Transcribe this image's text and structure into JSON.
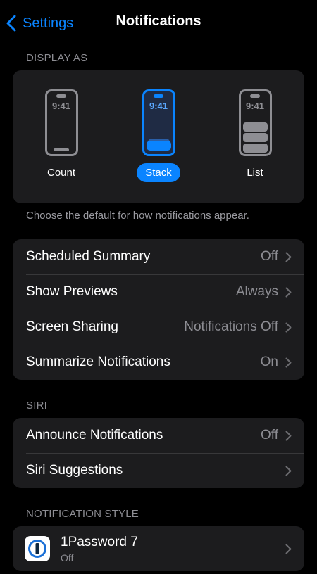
{
  "nav": {
    "back_label": "Settings",
    "title": "Notifications"
  },
  "display_as": {
    "header": "DISPLAY AS",
    "options": [
      {
        "label": "Count",
        "time": "9:41",
        "selected": false
      },
      {
        "label": "Stack",
        "time": "9:41",
        "selected": true
      },
      {
        "label": "List",
        "time": "9:41",
        "selected": false
      }
    ],
    "footer": "Choose the default for how notifications appear."
  },
  "general": {
    "rows": [
      {
        "label": "Scheduled Summary",
        "value": "Off"
      },
      {
        "label": "Show Previews",
        "value": "Always"
      },
      {
        "label": "Screen Sharing",
        "value": "Notifications Off"
      },
      {
        "label": "Summarize Notifications",
        "value": "On"
      }
    ]
  },
  "siri": {
    "header": "SIRI",
    "rows": [
      {
        "label": "Announce Notifications",
        "value": "Off"
      },
      {
        "label": "Siri Suggestions",
        "value": ""
      }
    ]
  },
  "notification_style": {
    "header": "NOTIFICATION STYLE",
    "apps": [
      {
        "name": "1Password 7",
        "status": "Off",
        "icon": "1password-icon"
      }
    ]
  },
  "colors": {
    "accent": "#0a84ff",
    "background": "#000000",
    "card": "#1c1c1e",
    "secondary_text": "#8d8d93"
  }
}
